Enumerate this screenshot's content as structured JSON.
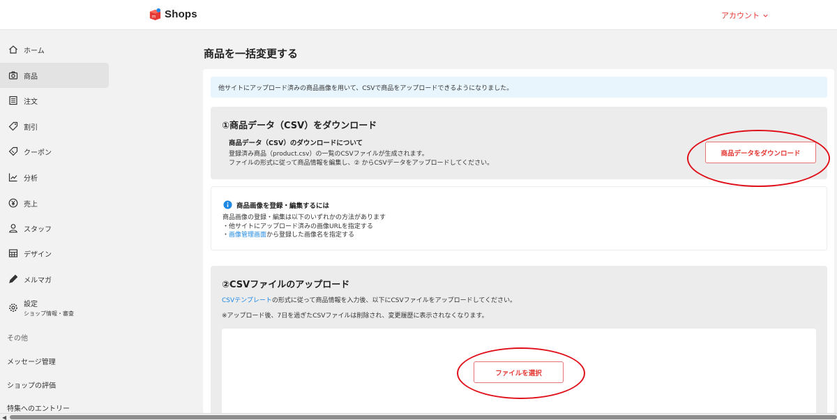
{
  "header": {
    "logo_text": "Shops",
    "account_label": "アカウント"
  },
  "sidebar": {
    "items": [
      {
        "label": "ホーム",
        "icon": "home-icon"
      },
      {
        "label": "商品",
        "icon": "camera-icon",
        "active": true
      },
      {
        "label": "注文",
        "icon": "order-icon"
      },
      {
        "label": "割引",
        "icon": "tag-icon"
      },
      {
        "label": "クーポン",
        "icon": "coupon-icon"
      },
      {
        "label": "分析",
        "icon": "chart-icon"
      },
      {
        "label": "売上",
        "icon": "yen-icon"
      },
      {
        "label": "スタッフ",
        "icon": "person-icon"
      },
      {
        "label": "デザイン",
        "icon": "design-icon"
      },
      {
        "label": "メルマガ",
        "icon": "pen-icon"
      },
      {
        "label": "設定",
        "sub": "ショップ情報・審査",
        "icon": "gear-icon"
      }
    ],
    "section_other": "その他",
    "links": [
      "メッセージ管理",
      "ショップの評価",
      "特集へのエントリー"
    ]
  },
  "main": {
    "title": "商品を一括変更する",
    "notice": "他サイトにアップロード済みの商品画像を用いて、CSVで商品をアップロードできるようになりました。",
    "section1": {
      "title": "①商品データ（CSV）をダウンロード",
      "subtitle": "商品データ（CSV）のダウンロードについて",
      "line1": "登録済み商品（product.csv）の一覧のCSVファイルが生成されます。",
      "line2": "ファイルの形式に従って商品情報を編集し、② からCSVデータをアップロードしてください。",
      "button": "商品データをダウンロード"
    },
    "info": {
      "title": "商品画像を登録・編集するには",
      "line1": "商品画像の登録・編集は以下のいずれかの方法があります",
      "line2": "・他サイトにアップロード済みの画像URLを指定する",
      "line3_prefix": "・",
      "line3_link": "画像管理画面",
      "line3_suffix": "から登録した画像名を指定する"
    },
    "section2": {
      "title": "②CSVファイルのアップロード",
      "desc_link": "CSVテンプレート",
      "desc_suffix": "の形式に従って商品情報を入力後、以下にCSVファイルをアップロードしてください。",
      "note": "※アップロード後、7日を過ぎたCSVファイルは削除され、変更履歴に表示されなくなります。",
      "button": "ファイルを選択"
    }
  },
  "colors": {
    "accent": "#e53935",
    "link": "#1e88e5",
    "annotation": "#e0101a"
  }
}
